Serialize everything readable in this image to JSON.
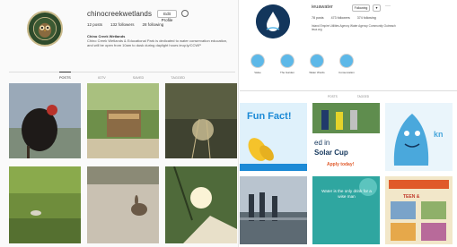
{
  "left_profile": {
    "username": "chinocreekwetlands",
    "follow_label": "Edit Profile",
    "stats": [
      "12 posts",
      "132 followers",
      "28 following"
    ],
    "bio_name": "Chino Creek Wetlands",
    "bio_text": "Chino Creek Wetlands & Educational Park is dedicated to water conservation education, and will be open from 10am to dusk during daylight hours ieuy.ly/CCWP",
    "tabs": [
      "POSTS",
      "IGTV",
      "SAVED",
      "TAGGED"
    ]
  },
  "right_profile": {
    "username": "ieuawater",
    "follow_label": "Following",
    "dropdown_label": "▾",
    "more_label": "···",
    "stats": [
      "78 posts",
      "473 followers",
      "374 following"
    ],
    "bio_text": "Inland Empire Utilities Agency Water Agency Community Outreach ieua.org",
    "highlights": [
      "Value",
      "The Garden",
      "Water Words",
      "Conservation"
    ],
    "tabs": [
      "POSTS",
      "TAGGED"
    ]
  },
  "posts": {
    "fun_fact_title": "Fun Fact!",
    "solar_text_1": "ed in",
    "solar_text_2": "Solar Cup",
    "solar_apply": "Apply today!",
    "knowledge_text": "kn",
    "quote_text": "Water is the only drink for a wise man",
    "teen_text": "TEEN &"
  },
  "colors": {
    "ig_bg": "#fafafa",
    "highlight_blue": "#5db8e8",
    "ieua_navy": "#13365c",
    "fun_fact_blue": "#1c8ad6"
  }
}
